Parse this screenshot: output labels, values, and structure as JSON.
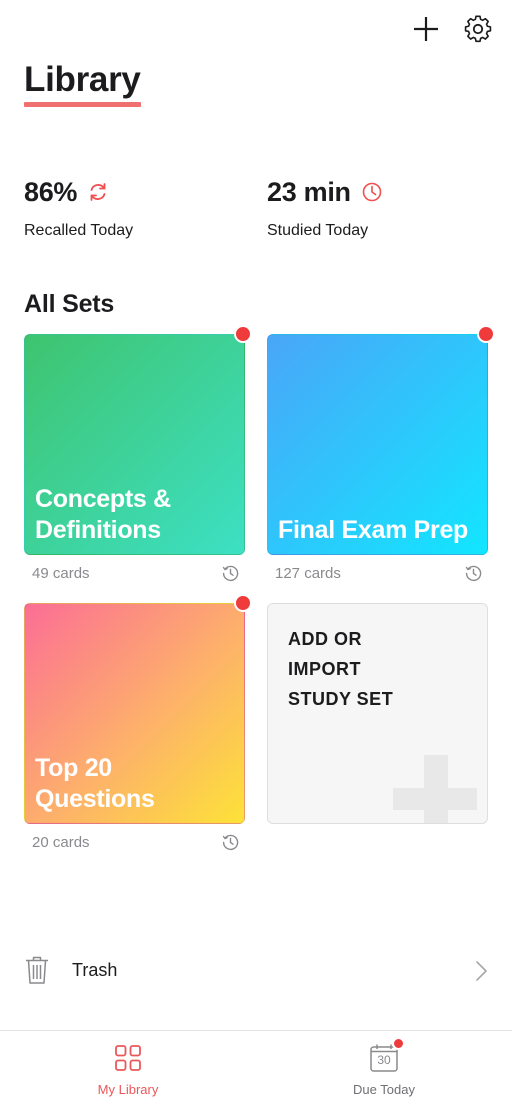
{
  "header": {
    "title": "Library",
    "icons": [
      "plus-icon",
      "gear-icon"
    ],
    "accent_color": "#f07070"
  },
  "stats": [
    {
      "value": "86%",
      "label": "Recalled Today",
      "icon": "refresh-icon"
    },
    {
      "value": "23 min",
      "label": "Studied Today",
      "icon": "clock-icon"
    }
  ],
  "sets_section": {
    "title": "All Sets",
    "cards": [
      {
        "title": "Concepts & Definitions",
        "count": "49 cards",
        "has_badge": true
      },
      {
        "title": "Final Exam Prep",
        "count": "127 cards",
        "has_badge": true
      },
      {
        "title": "Top 20 Questions",
        "count": "20 cards",
        "has_badge": true
      }
    ],
    "add_card": {
      "label_lines": [
        "ADD OR",
        "IMPORT",
        "STUDY SET"
      ]
    }
  },
  "trash": {
    "label": "Trash"
  },
  "tabbar": {
    "tabs": [
      {
        "label": "My Library",
        "active": true,
        "icon": "grid-icon"
      },
      {
        "label": "Due Today",
        "active": false,
        "icon": "calendar-icon",
        "icon_text": "30",
        "has_badge": true
      }
    ]
  },
  "colors": {
    "badge": "#ef3b3b",
    "active_tab": "#e9585b",
    "text": "#1c1c1e",
    "muted": "#8a8a8e"
  }
}
